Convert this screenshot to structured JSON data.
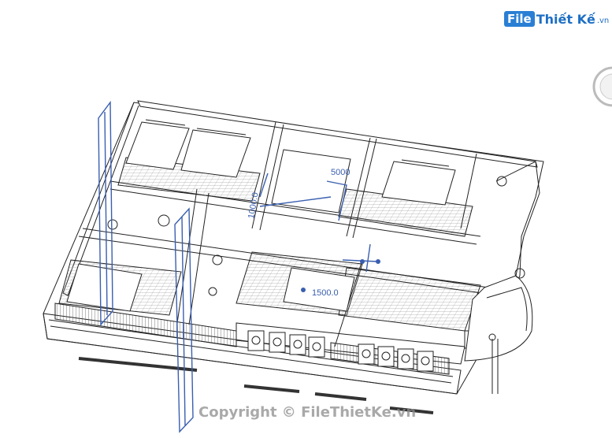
{
  "brand": {
    "file_badge": "File",
    "name": "Thiết Kế",
    "tld": ".vn"
  },
  "watermark": "Copyright © FileThietKe.vn",
  "dimensions": {
    "horizontal": "5000",
    "vertical": "1000.0",
    "bottom": "1500.0"
  },
  "colors": {
    "line": "#222222",
    "selection": "#3a5fb0",
    "brand": "#1d6fc5"
  },
  "icons": {
    "viewcube": "viewcube-icon"
  }
}
